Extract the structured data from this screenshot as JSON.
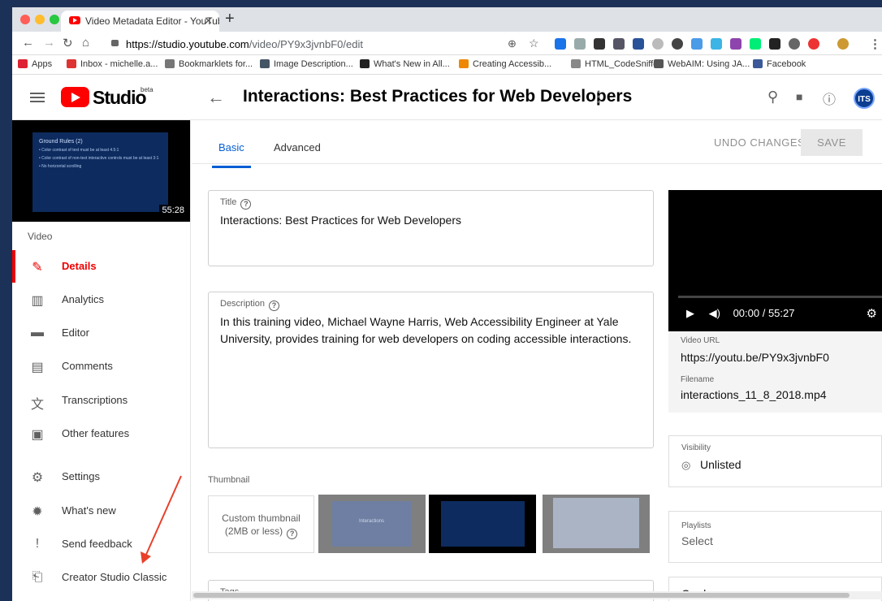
{
  "browser": {
    "tab_title": "Video Metadata Editor - YouTube",
    "url_host": "https://studio.youtube.com",
    "url_path": "/video/PY9x3jvnbF0/edit"
  },
  "bookmarks": [
    {
      "label": "Apps",
      "color": "#d23"
    },
    {
      "label": "Inbox - michelle.a...",
      "color": "#d33"
    },
    {
      "label": "Bookmarklets for...",
      "color": "#777"
    },
    {
      "label": "Image Description...",
      "color": "#456"
    },
    {
      "label": "What's New in All...",
      "color": "#222"
    },
    {
      "label": "Creating Accessib...",
      "color": "#e80"
    },
    {
      "label": "HTML_CodeSniffer",
      "color": "#888"
    },
    {
      "label": "WebAIM: Using JA...",
      "color": "#555"
    },
    {
      "label": "Facebook",
      "color": "#3b5998"
    }
  ],
  "header": {
    "logo_text": "Studio",
    "beta": "beta",
    "page_title": "Interactions: Best Practices for Web Developers",
    "avatar": "ITS"
  },
  "sidebar": {
    "thumb_title": "Ground Rules (2)",
    "thumb_lines": [
      "• Color contrast of text must be at least 4.5:1",
      "• Color contrast of non-text interactive controls must be at least 3:1",
      "• No horizontal scrolling"
    ],
    "duration": "55:28",
    "section_label": "Video",
    "items": [
      {
        "label": "Details",
        "icon": "pencil-icon",
        "glyph": "✎"
      },
      {
        "label": "Analytics",
        "icon": "analytics-icon",
        "glyph": "▥"
      },
      {
        "label": "Editor",
        "icon": "editor-icon",
        "glyph": "▬"
      },
      {
        "label": "Comments",
        "icon": "comments-icon",
        "glyph": "▤"
      },
      {
        "label": "Transcriptions",
        "icon": "transcriptions-icon",
        "glyph": "文"
      },
      {
        "label": "Other features",
        "icon": "other-features-icon",
        "glyph": "▣"
      },
      {
        "label": "Settings",
        "icon": "gear-icon",
        "glyph": "⚙"
      },
      {
        "label": "What's new",
        "icon": "whats-new-icon",
        "glyph": "✹"
      },
      {
        "label": "Send feedback",
        "icon": "feedback-icon",
        "glyph": "!"
      },
      {
        "label": "Creator Studio Classic",
        "icon": "classic-icon",
        "glyph": "⎗"
      }
    ]
  },
  "tabs": {
    "basic": "Basic",
    "advanced": "Advanced"
  },
  "actions": {
    "undo": "UNDO CHANGES",
    "save": "SAVE"
  },
  "form": {
    "title_label": "Title",
    "title_value": "Interactions: Best Practices for Web Developers",
    "description_label": "Description",
    "description_value": "In this training video, Michael Wayne Harris, Web Accessibility Engineer at Yale University, provides training for web developers on coding accessible interactions.",
    "thumbnail_label": "Thumbnail",
    "custom_thumbnail_line1": "Custom thumbnail",
    "custom_thumbnail_line2": "(2MB or less)",
    "thumb1_text": "Interactions",
    "tags_label": "Tags"
  },
  "player": {
    "time": "00:00 / 55:27",
    "video_url_label": "Video URL",
    "video_url": "https://youtu.be/PY9x3jvnbF0",
    "filename_label": "Filename",
    "filename": "interactions_11_8_2018.mp4"
  },
  "visibility": {
    "label": "Visibility",
    "value": "Unlisted"
  },
  "playlists": {
    "label": "Playlists",
    "value": "Select"
  },
  "cards": {
    "label": "Cards"
  },
  "colors": {
    "accent": "#065fd4",
    "active": "#e00000",
    "annotation_arrow": "#e8402a"
  }
}
